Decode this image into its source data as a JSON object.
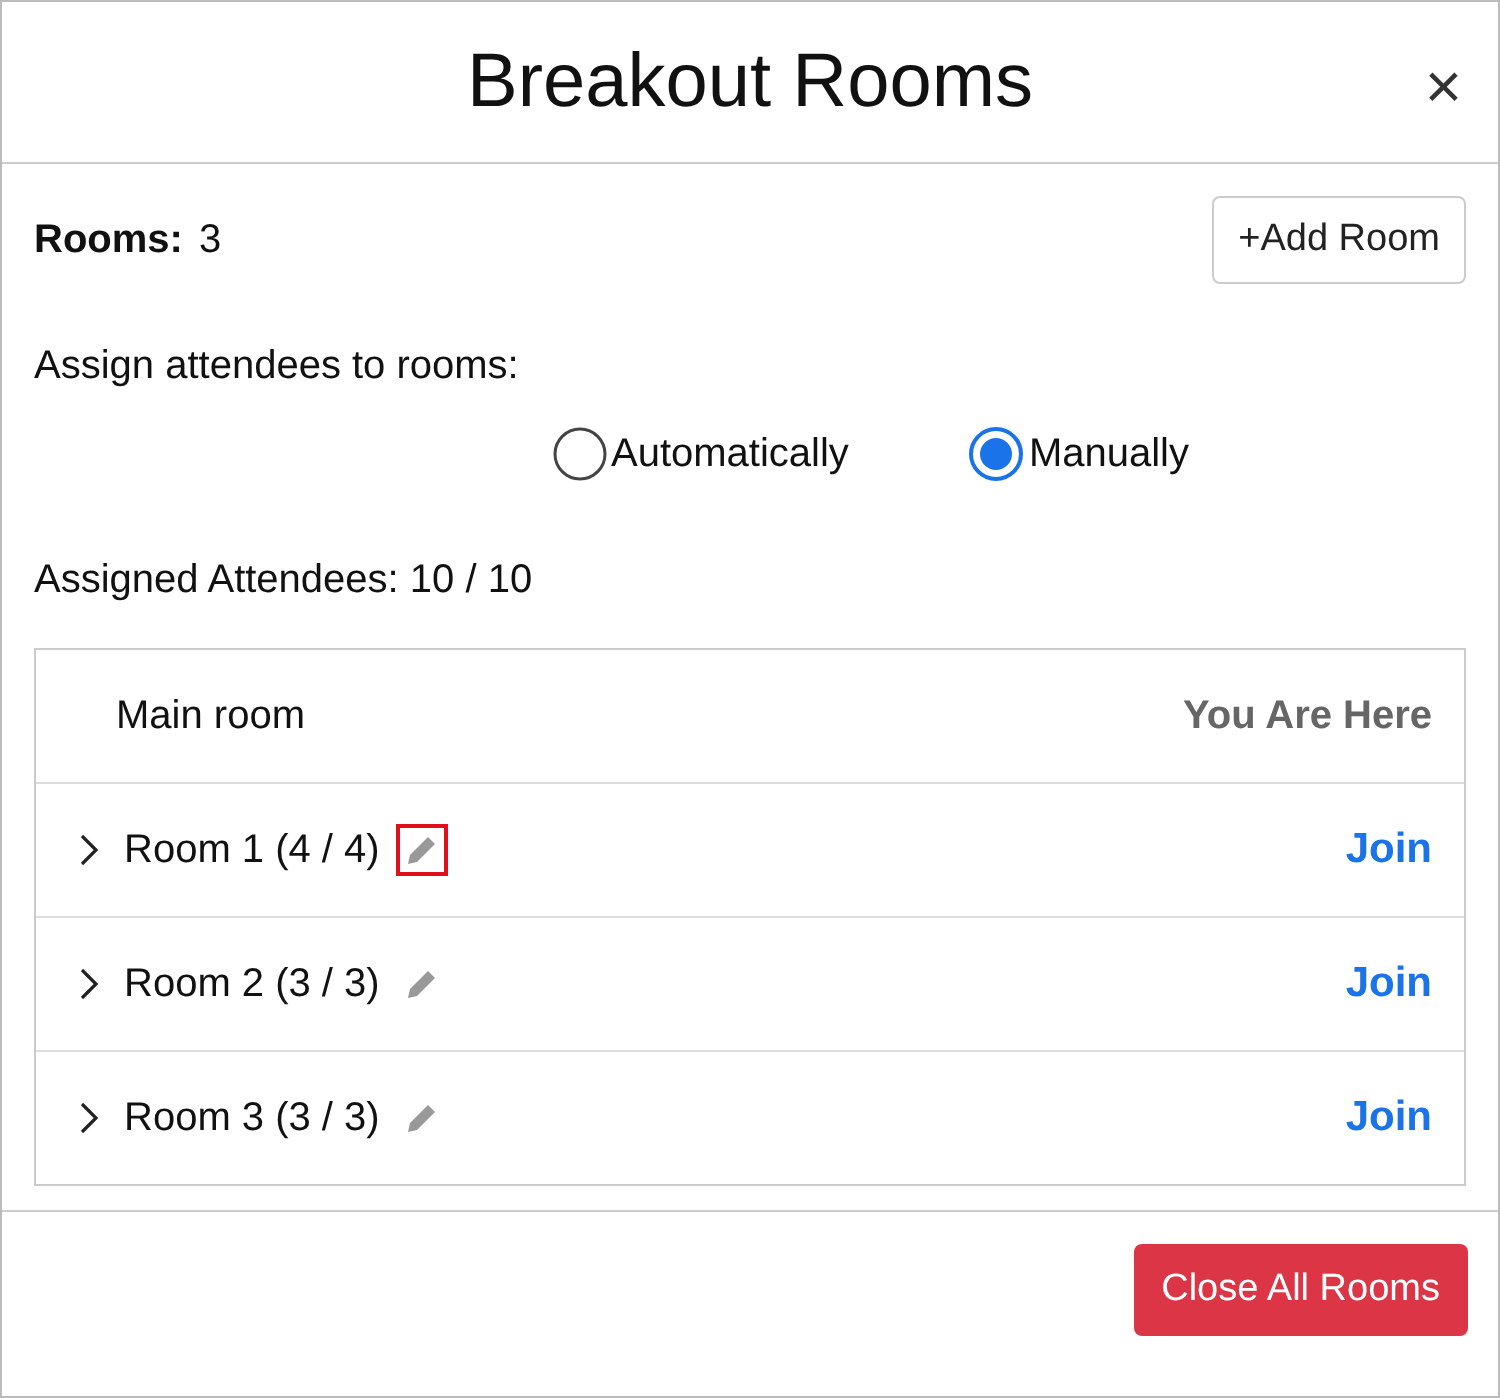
{
  "dialog": {
    "title": "Breakout Rooms",
    "close": "×"
  },
  "rooms_count": {
    "label": "Rooms:",
    "value": "3"
  },
  "add_room": "+Add Room",
  "assign": {
    "label": "Assign attendees to rooms:",
    "options": [
      {
        "label": "Automatically",
        "selected": false
      },
      {
        "label": "Manually",
        "selected": true
      }
    ]
  },
  "assigned": "Assigned Attendees: 10 / 10",
  "main_room": {
    "name": "Main room",
    "status": "You Are Here"
  },
  "rooms": [
    {
      "name": "Room 1 (4 / 4)",
      "action": "Join",
      "expanded": false,
      "highlighted": true
    },
    {
      "name": "Room 2 (3 / 3)",
      "action": "Join",
      "expanded": false,
      "highlighted": false
    },
    {
      "name": "Room 3 (3 / 3)",
      "action": "Join",
      "expanded": false,
      "highlighted": false
    }
  ],
  "close_all": "Close All Rooms"
}
